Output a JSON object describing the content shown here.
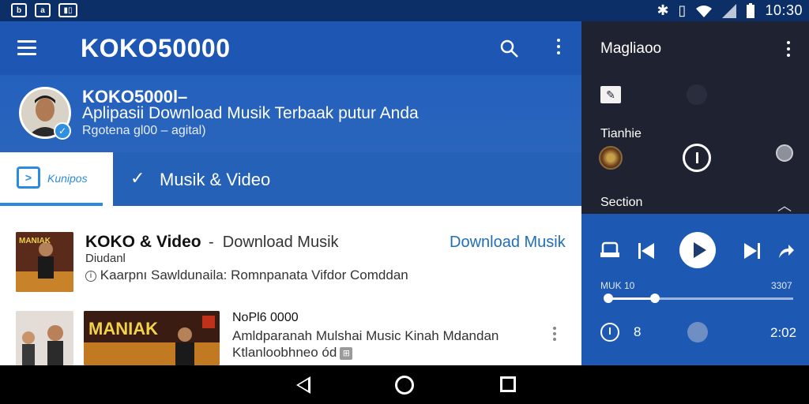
{
  "status_bar": {
    "left_icons": [
      "b",
      "a",
      "sim-icon"
    ],
    "time": "10:30",
    "right_icons": [
      "bluetooth-icon",
      "vibrate-icon",
      "wifi-icon",
      "signal-icon",
      "battery-icon"
    ]
  },
  "app_bar": {
    "title": "KOKO50000",
    "icons": [
      "menu-icon",
      "search-icon",
      "overflow-icon"
    ]
  },
  "profile": {
    "name": "KOKO5000l–",
    "subtitle": "Aplipasii Download Musik Terbaak putur Anda",
    "meta": "Rgotena gl00 – agital)"
  },
  "tabs": [
    {
      "label": "Kunipos",
      "active": true
    },
    {
      "label": "Musik & Video",
      "active": false
    }
  ],
  "list": [
    {
      "title": "KOKO & Video",
      "dash": "-",
      "subtitle_right": "Download Musik",
      "link": "Download Musik",
      "sub": "Diudanl",
      "meta": "Kaarpnı Sawldunaila:  Romnpanata Vifdor  Comddan",
      "thumb_text": "MANIAK"
    },
    {
      "title": "NoPl6 0000",
      "desc": "Amldparanah Mulshai Music Kinah Mdandan",
      "meta": "Ktlanloobhneo ód",
      "thumb_text": "MANIAK"
    }
  ],
  "side_panel": {
    "title": "Magliaoo",
    "track_label": "Tianhie",
    "section_label": "Section",
    "player": {
      "left_label": "MUK 10",
      "right_label": "3307",
      "progress": 0.26,
      "number": "8",
      "time": "2:02"
    }
  },
  "nav_bar": {
    "buttons": [
      "back-icon",
      "home-icon",
      "recents-icon"
    ]
  },
  "colors": {
    "app_bar": "#1d57b3",
    "accent": "#2a8be0",
    "side_panel": "#1f2230",
    "player": "#1d58b3"
  }
}
